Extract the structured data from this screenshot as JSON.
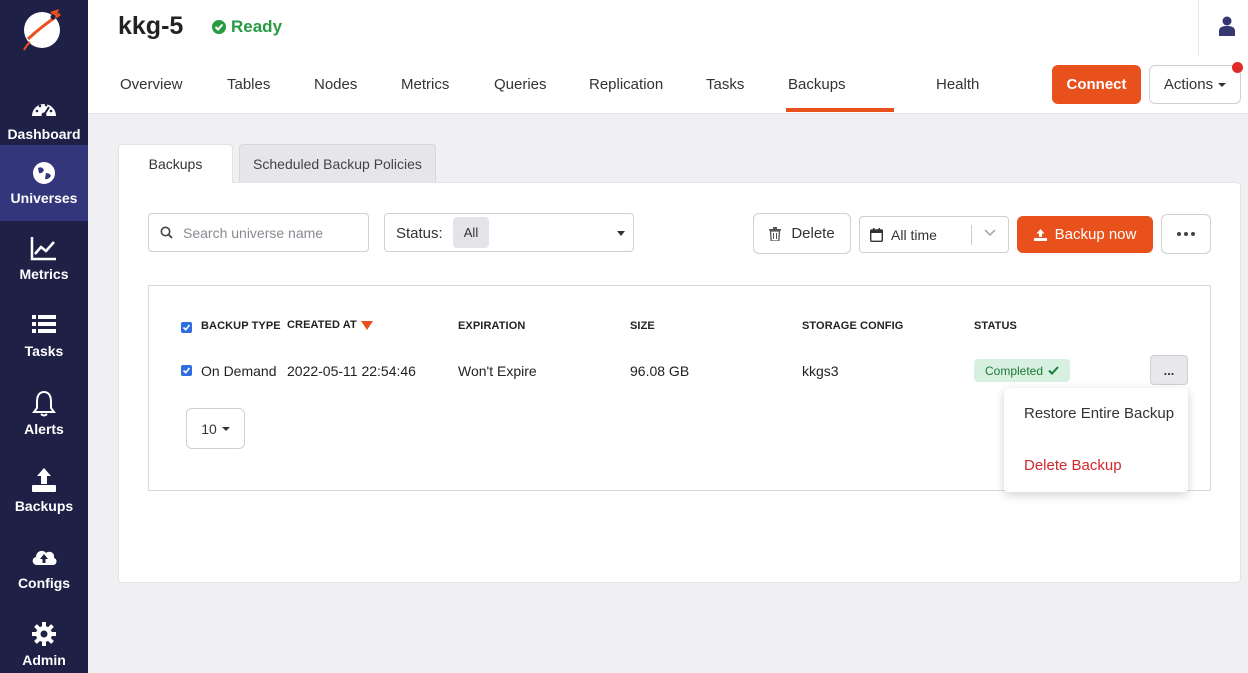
{
  "sidebar": {
    "items": [
      {
        "label": "Dashboard",
        "icon": "dashboard-gauge-icon"
      },
      {
        "label": "Universes",
        "icon": "globe-icon"
      },
      {
        "label": "Metrics",
        "icon": "line-chart-icon"
      },
      {
        "label": "Tasks",
        "icon": "list-icon"
      },
      {
        "label": "Alerts",
        "icon": "bell-icon"
      },
      {
        "label": "Backups",
        "icon": "upload-tray-icon"
      },
      {
        "label": "Configs",
        "icon": "cloud-upload-icon"
      },
      {
        "label": "Admin",
        "icon": "gear-icon"
      }
    ],
    "active": "Universes"
  },
  "header": {
    "universe_name": "kkg-5",
    "status": "Ready",
    "tabs": [
      "Overview",
      "Tables",
      "Nodes",
      "Metrics",
      "Queries",
      "Replication",
      "Tasks",
      "Backups",
      "Health"
    ],
    "active_tab": "Backups",
    "connect_label": "Connect",
    "actions_label": "Actions"
  },
  "subtabs": {
    "backups": "Backups",
    "scheduled": "Scheduled Backup Policies"
  },
  "toolbar": {
    "search_placeholder": "Search universe name",
    "status_label": "Status:",
    "status_value": "All",
    "delete_label": "Delete",
    "time_value": "All time",
    "backup_now_label": "Backup now"
  },
  "table": {
    "columns": [
      "BACKUP TYPE",
      "CREATED AT",
      "EXPIRATION",
      "SIZE",
      "STORAGE CONFIG",
      "STATUS"
    ],
    "rows": [
      {
        "backup_type": "On Demand",
        "created_at": "2022-05-11 22:54:46",
        "expiration": "Won't Expire",
        "size": "96.08 GB",
        "storage_config": "kkgs3",
        "status": "Completed"
      }
    ],
    "row_menu_label": "...",
    "page_size": "10"
  },
  "row_menu": {
    "restore": "Restore Entire Backup",
    "delete": "Delete Backup"
  },
  "colors": {
    "sidebar_bg": "#1e2046",
    "sidebar_active": "#33367a",
    "accent": "#e8501c",
    "ready_green": "#289b42",
    "danger_red": "#d0282c",
    "checkbox_blue": "#2e6ee0"
  }
}
